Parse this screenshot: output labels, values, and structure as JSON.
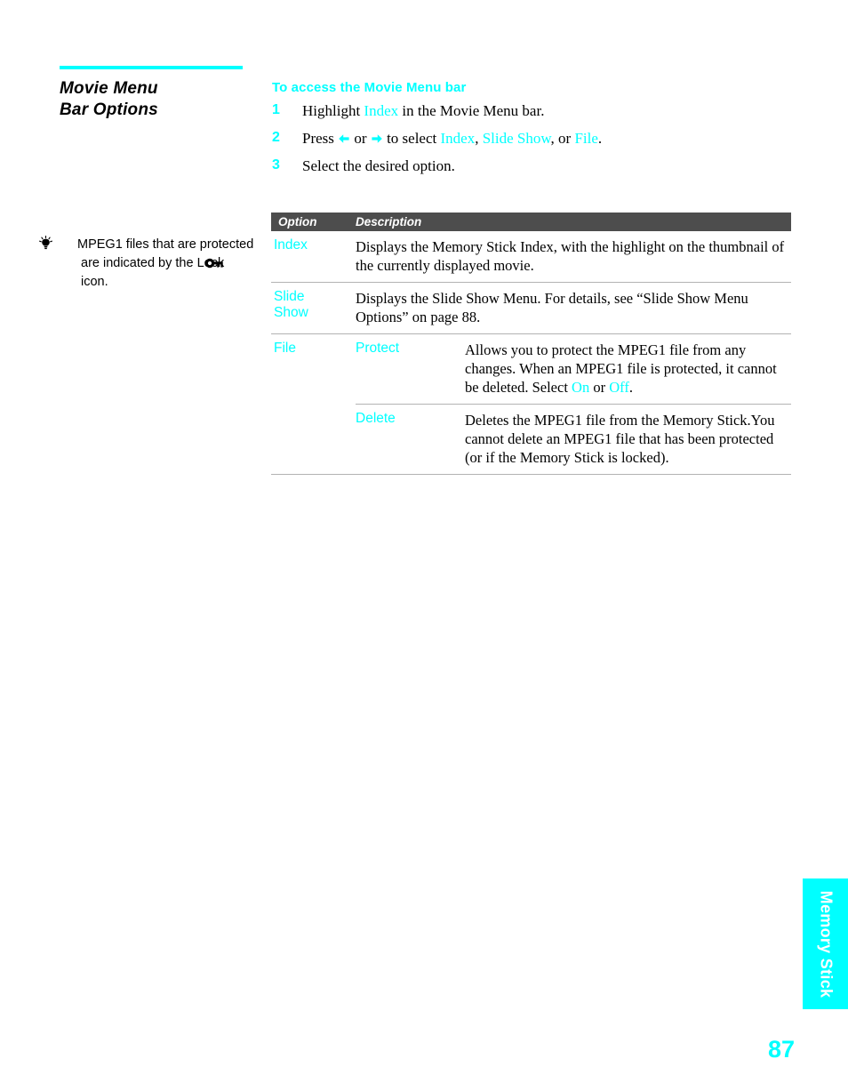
{
  "colors": {
    "accent": "#00ffff",
    "table_header_bg": "#4d4d4d",
    "rule_gray": "#b3b3b3",
    "text": "#000000"
  },
  "section": {
    "title_line1": "Movie Menu",
    "title_line2": "Bar Options"
  },
  "tip": {
    "icon": "light-bulb-icon",
    "text_before_icon": "MPEG1 files that are protected are indicated by the Lock",
    "inline_icon": "key-icon",
    "text_after_icon": "icon."
  },
  "procedure": {
    "heading": "To access the Movie Menu bar",
    "steps": [
      {
        "number": "1",
        "parts": [
          {
            "text": "Highlight ",
            "style": "plain"
          },
          {
            "text": "Index",
            "style": "accent"
          },
          {
            "text": " in the Movie Menu bar.",
            "style": "plain"
          }
        ]
      },
      {
        "number": "2",
        "parts": [
          {
            "text": "Press ",
            "style": "plain"
          },
          {
            "text": "left-arrow-icon",
            "style": "icon"
          },
          {
            "text": " or ",
            "style": "plain"
          },
          {
            "text": "right-arrow-icon",
            "style": "icon"
          },
          {
            "text": " to select ",
            "style": "plain"
          },
          {
            "text": "Index",
            "style": "accent"
          },
          {
            "text": ", ",
            "style": "plain"
          },
          {
            "text": "Slide Show",
            "style": "accent"
          },
          {
            "text": ", or ",
            "style": "plain"
          },
          {
            "text": "File",
            "style": "accent"
          },
          {
            "text": ".",
            "style": "plain"
          }
        ]
      },
      {
        "number": "3",
        "parts": [
          {
            "text": "Select the desired option.",
            "style": "plain"
          }
        ]
      }
    ],
    "step1_text": "Highlight Index in the Movie Menu bar.",
    "step3_text": "Select the desired option."
  },
  "table": {
    "headers": {
      "option": "Option",
      "description": "Description"
    },
    "rows": [
      {
        "option": "Index",
        "description": "Displays the Memory Stick Index, with the highlight on the thumbnail of the currently displayed movie."
      },
      {
        "option": "Slide Show",
        "option_line1": "Slide",
        "option_line2": "Show",
        "description": "Displays the Slide Show Menu. For details, see “Slide Show Menu Options” on page 88."
      }
    ],
    "file_row": {
      "option": "File",
      "subrows": [
        {
          "suboption": "Protect",
          "description_parts": [
            {
              "text": "Allows you to protect the MPEG1 file from any changes. When an MPEG1 file is protected, it cannot be deleted. Select ",
              "style": "plain"
            },
            {
              "text": "On",
              "style": "accent"
            },
            {
              "text": " or ",
              "style": "plain"
            },
            {
              "text": "Off",
              "style": "accent"
            },
            {
              "text": ".",
              "style": "plain"
            }
          ],
          "description": "Allows you to protect the MPEG1 file from any changes. When an MPEG1 file is protected, it cannot be deleted. Select On or Off."
        },
        {
          "suboption": "Delete",
          "description": "Deletes the MPEG1 file from the Memory Stick.You cannot delete an MPEG1 file that has been protected (or if the Memory Stick is locked)."
        }
      ]
    }
  },
  "thumb_tab": {
    "label": "Memory Stick"
  },
  "folio": {
    "page_number": "87"
  }
}
